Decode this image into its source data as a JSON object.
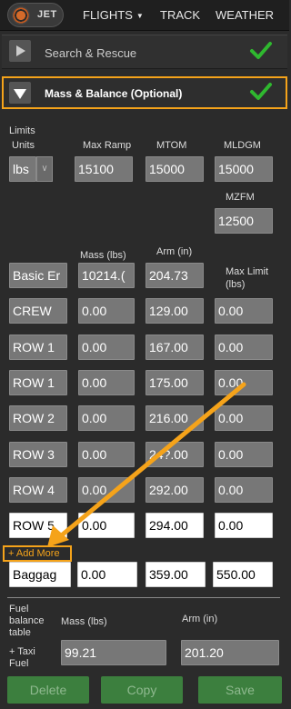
{
  "nav": {
    "logo_text": "JET",
    "flights": "FLIGHTS",
    "track": "TRACK",
    "weather": "WEATHER"
  },
  "sections": {
    "search_rescue": "Search & Rescue",
    "mass_balance": "Mass & Balance (Optional)"
  },
  "limits": {
    "heading": "Limits",
    "units_label": "Units",
    "units_value": "lbs",
    "max_ramp_label": "Max Ramp",
    "max_ramp": "15100",
    "mtom_label": "MTOM",
    "mtom": "15000",
    "mldgm_label": "MLDGM",
    "mldgm": "15000",
    "mzfm_label": "MZFM",
    "mzfm": "12500"
  },
  "table": {
    "mass_header": "Mass (lbs)",
    "arm_header": "Arm (in)",
    "max_limit_header": "Max Limit (lbs)",
    "rows": [
      {
        "name": "Basic Er",
        "mass": "10214.(",
        "arm": "204.73",
        "limit": ""
      },
      {
        "name": "CREW",
        "mass": "0.00",
        "arm": "129.00",
        "limit": "0.00"
      },
      {
        "name": "ROW 1",
        "mass": "0.00",
        "arm": "167.00",
        "limit": "0.00"
      },
      {
        "name": "ROW 1",
        "mass": "0.00",
        "arm": "175.00",
        "limit": "0.00"
      },
      {
        "name": "ROW 2",
        "mass": "0.00",
        "arm": "216.00",
        "limit": "0.00"
      },
      {
        "name": "ROW 3",
        "mass": "0.00",
        "arm": "24?.00",
        "limit": "0.00"
      },
      {
        "name": "ROW 4",
        "mass": "0.00",
        "arm": "292.00",
        "limit": "0.00"
      },
      {
        "name": "ROW 5",
        "mass": "0.00",
        "arm": "294.00",
        "limit": "0.00"
      }
    ],
    "add_more": "+ Add More",
    "baggage": {
      "name": "Baggag",
      "mass": "0.00",
      "arm": "359.00",
      "limit": "550.00"
    }
  },
  "fuel": {
    "label_line1": "Fuel",
    "label_line2": "balance",
    "label_line3": "table",
    "mass_header": "Mass (lbs)",
    "arm_header": "Arm (in)",
    "taxi_line1": "+ Taxi",
    "taxi_line2": "Fuel",
    "mass": "99.21",
    "arm": "201.20"
  },
  "buttons": {
    "delete": "Delete",
    "copy": "Copy",
    "save": "Save"
  },
  "colors": {
    "highlight": "#f5a31a",
    "check_green": "#2fb82f",
    "button_green": "#3c7f3e"
  }
}
